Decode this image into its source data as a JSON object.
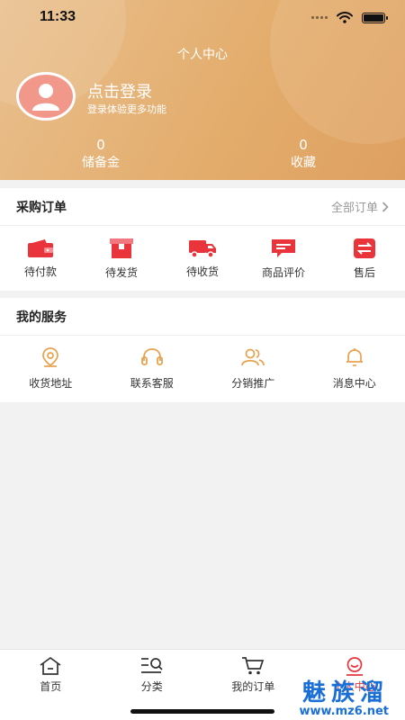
{
  "status_bar": {
    "time": "11:33"
  },
  "header": {
    "title": "个人中心",
    "login_title": "点击登录",
    "login_subtitle": "登录体验更多功能",
    "stats": [
      {
        "value": "0",
        "label": "储备金"
      },
      {
        "value": "0",
        "label": "收藏"
      }
    ]
  },
  "orders": {
    "title": "采购订单",
    "all_link": "全部订单",
    "items": [
      {
        "label": "待付款",
        "icon": "wallet-icon"
      },
      {
        "label": "待发货",
        "icon": "package-icon"
      },
      {
        "label": "待收货",
        "icon": "truck-icon"
      },
      {
        "label": "商品评价",
        "icon": "comment-icon"
      },
      {
        "label": "售后",
        "icon": "exchange-icon"
      }
    ]
  },
  "services": {
    "title": "我的服务",
    "items": [
      {
        "label": "收货地址",
        "icon": "location-pin-icon"
      },
      {
        "label": "联系客服",
        "icon": "headset-icon"
      },
      {
        "label": "分销推广",
        "icon": "users-icon"
      },
      {
        "label": "消息中心",
        "icon": "bell-icon"
      }
    ]
  },
  "tabbar": {
    "items": [
      {
        "label": "首页",
        "icon": "home-icon"
      },
      {
        "label": "分类",
        "icon": "category-search-icon"
      },
      {
        "label": "我的订单",
        "icon": "cart-icon"
      },
      {
        "label": "个人中心",
        "icon": "user-icon",
        "active": true
      }
    ]
  },
  "watermark": {
    "title": "魅族溜",
    "url": "www.mz6.net"
  },
  "colors": {
    "accent": "#e9343c",
    "header": "#e3ac6b",
    "service_icon": "#e8a24e"
  }
}
